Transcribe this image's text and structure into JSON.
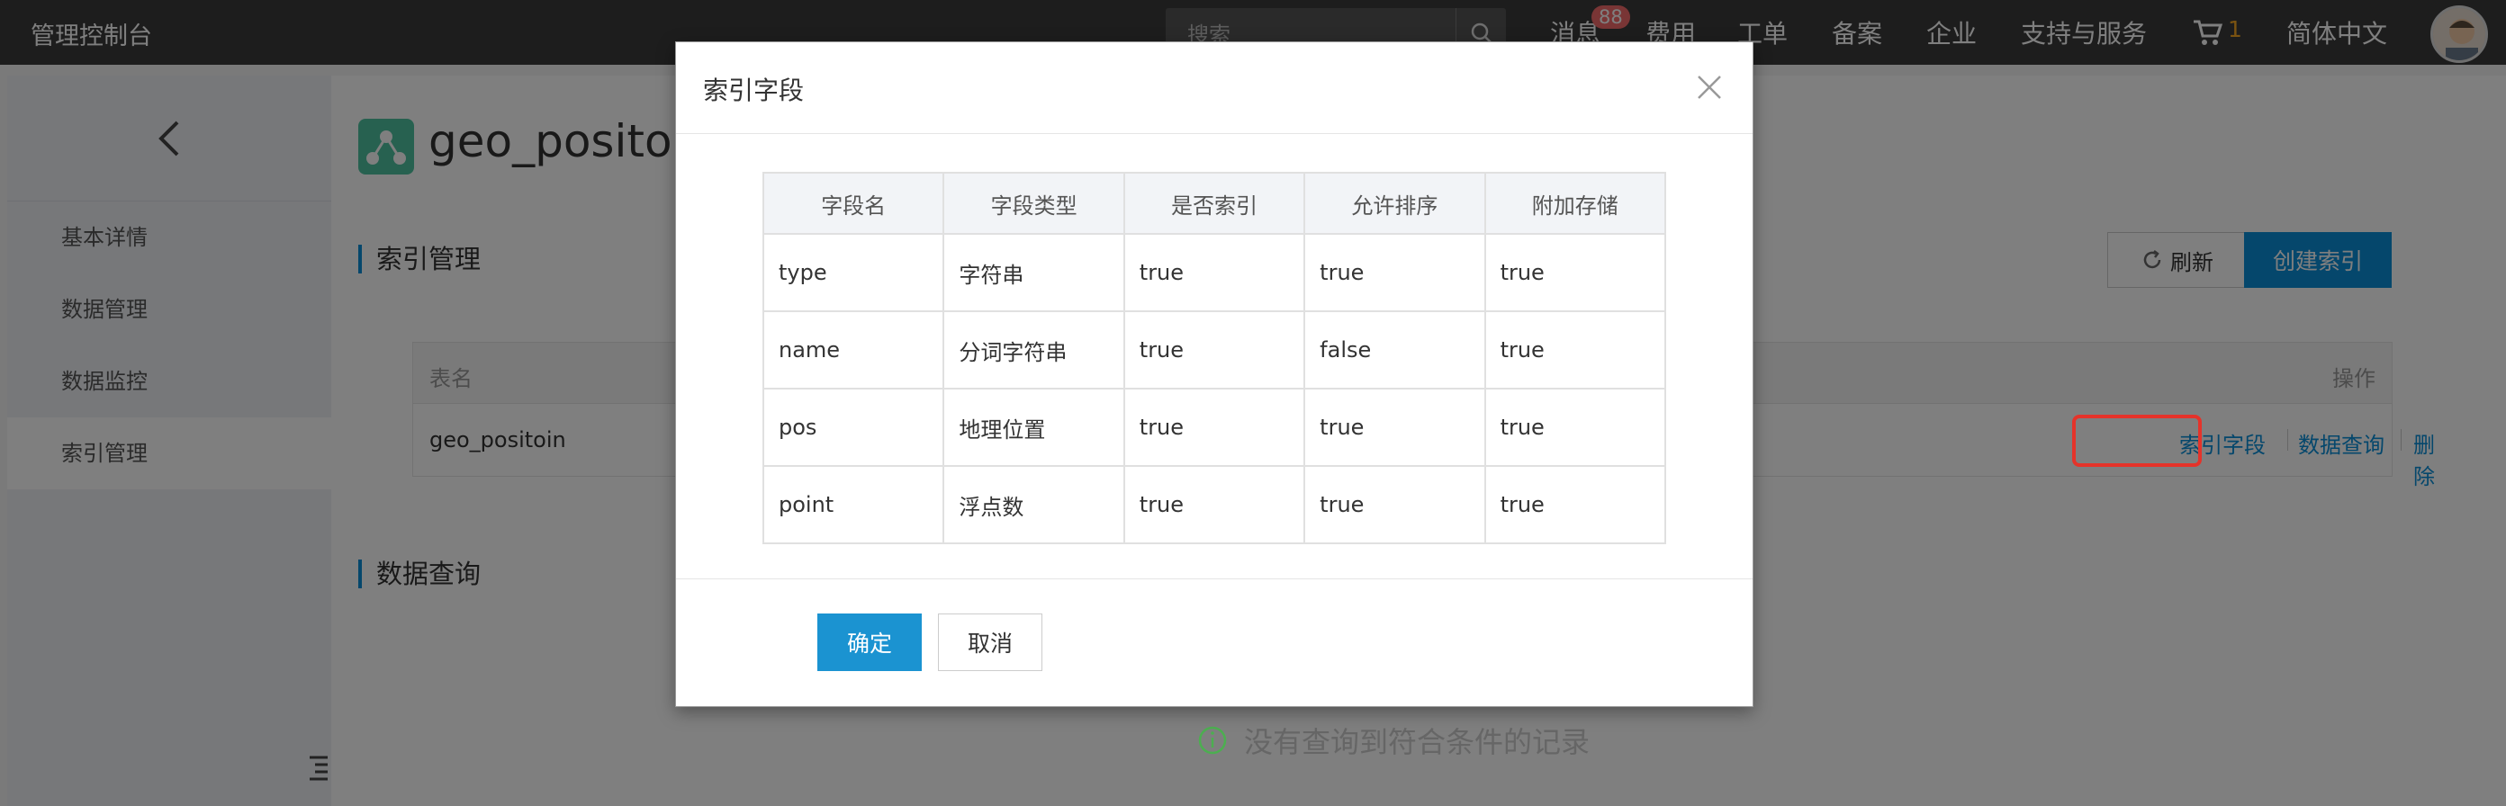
{
  "topbar": {
    "brand": "管理控制台",
    "search_placeholder": "搜索",
    "nav": {
      "messages": "消息",
      "messages_badge": "88",
      "fees": "费用",
      "tickets": "工单",
      "filing": "备案",
      "enterprise": "企业",
      "support": "支持与服务",
      "cart_count": "1",
      "language": "简体中文"
    }
  },
  "sidebar": {
    "items": [
      {
        "label": "基本详情"
      },
      {
        "label": "数据管理"
      },
      {
        "label": "数据监控"
      },
      {
        "label": "索引管理"
      }
    ]
  },
  "main": {
    "title": "geo_positoin",
    "index_section": "索引管理",
    "refresh_label": "刷新",
    "create_index_label": "创建索引",
    "table": {
      "col_name": "表名",
      "col_ops": "操作",
      "row_name": "geo_positoin",
      "ops": {
        "index_fields": "索引字段",
        "data_query": "数据查询",
        "delete": "删除"
      }
    },
    "query_section": "数据查询",
    "empty_text": "没有查询到符合条件的记录"
  },
  "modal": {
    "title": "索引字段",
    "headers": [
      "字段名",
      "字段类型",
      "是否索引",
      "允许排序",
      "附加存储"
    ],
    "rows": [
      [
        "type",
        "字符串",
        "true",
        "true",
        "true"
      ],
      [
        "name",
        "分词字符串",
        "true",
        "false",
        "true"
      ],
      [
        "pos",
        "地理位置",
        "true",
        "true",
        "true"
      ],
      [
        "point",
        "浮点数",
        "true",
        "true",
        "true"
      ]
    ],
    "ok_label": "确定",
    "cancel_label": "取消"
  },
  "colors": {
    "primary": "#1b93d1",
    "highlight_border": "#e5332a",
    "badge": "#f26b6b",
    "cart_count": "#f5a623"
  }
}
